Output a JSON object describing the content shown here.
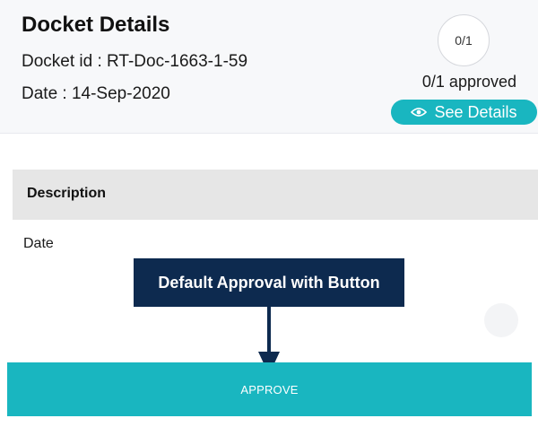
{
  "header": {
    "title": "Docket Details",
    "docket_id": "Docket id : RT-Doc-1663-1-59",
    "date": "Date : 14-Sep-2020",
    "progress": "0/1",
    "approved_status": "0/1 approved",
    "see_details_label": "See Details",
    "see_details_icon": "eye-icon",
    "accent_color": "#19b6c0"
  },
  "table": {
    "header": "Description",
    "rows": [
      "Date"
    ]
  },
  "callout": {
    "text": "Default Approval with Button",
    "color": "#0d2a4f"
  },
  "footer": {
    "approve_label": "APPROVE"
  }
}
